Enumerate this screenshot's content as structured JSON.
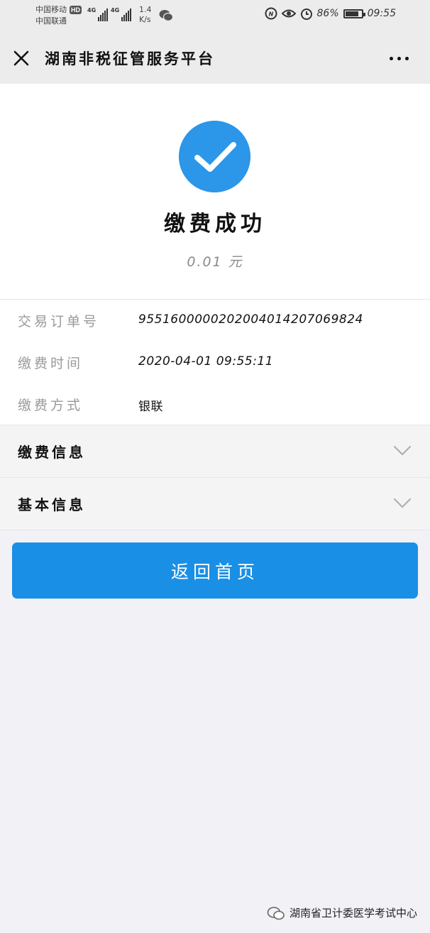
{
  "status_bar": {
    "carrier_1": "中国移动",
    "carrier_badge": "HD",
    "carrier_2": "中国联通",
    "network_1": "4G",
    "network_2": "4G",
    "speed_value": "1.4",
    "speed_unit": "K/s",
    "battery_percent": "86%",
    "time": "09:55"
  },
  "header": {
    "title": "湖南非税征管服务平台"
  },
  "result": {
    "title": "缴费成功",
    "amount": "0.01 元"
  },
  "details": [
    {
      "label": "交易订单号",
      "value": "955160000020200401420706982​4"
    },
    {
      "label": "缴费时间",
      "value": "2020-04-01 09:55:11"
    },
    {
      "label": "缴费方式",
      "value": "银联"
    }
  ],
  "sections": [
    {
      "label": "缴费信息"
    },
    {
      "label": "基本信息"
    }
  ],
  "actions": {
    "home_label": "返回首页"
  },
  "watermark": {
    "text": "湖南省卫计委医学考试中心"
  },
  "colors": {
    "accent": "#1a8fe6",
    "success_icon": "#2c96e8",
    "header_bg": "#ececec",
    "page_bg": "#f2f2f6"
  }
}
